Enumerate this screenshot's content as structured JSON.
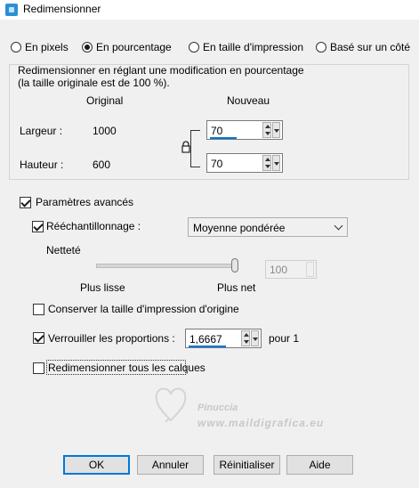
{
  "window": {
    "title": "Redimensionner"
  },
  "modes": [
    {
      "label": "En pixels",
      "selected": false
    },
    {
      "label": "En pourcentage",
      "selected": true
    },
    {
      "label": "En taille d'impression",
      "selected": false
    },
    {
      "label": "Basé sur un côté",
      "selected": false
    }
  ],
  "group": {
    "caption_line1": "Redimensionner en réglant une modification en pourcentage",
    "caption_line2": "(la taille originale est de 100 %).",
    "col_original": "Original",
    "col_new": "Nouveau",
    "width_label": "Largeur :",
    "width_original": "1000",
    "width_new": "70",
    "height_label": "Hauteur :",
    "height_original": "600",
    "height_new": "70"
  },
  "advanced": {
    "label": "Paramètres avancés",
    "checked": true,
    "resample_label": "Rééchantillonnage :",
    "resample_checked": true,
    "resample_method": "Moyenne pondérée",
    "sharpness_label": "Netteté",
    "slider_left": "Plus lisse",
    "slider_right": "Plus net",
    "sharpness_value": "100",
    "sharpness_level": 1.0,
    "keep_print_size_label": "Conserver la taille d'impression d'origine",
    "keep_print_size_checked": false,
    "lock_ratio_label": "Verrouiller les proportions :",
    "lock_ratio_checked": true,
    "ratio_value": "1,6667",
    "ratio_suffix": "pour 1",
    "resize_all_layers_label": "Redimensionner tous les calques",
    "resize_all_layers_checked": false
  },
  "watermark": {
    "name": "Pinuccia",
    "site": "www.maildigrafica.eu"
  },
  "buttons": {
    "ok": "OK",
    "cancel": "Annuler",
    "reset": "Réinitialiser",
    "help": "Aide"
  }
}
